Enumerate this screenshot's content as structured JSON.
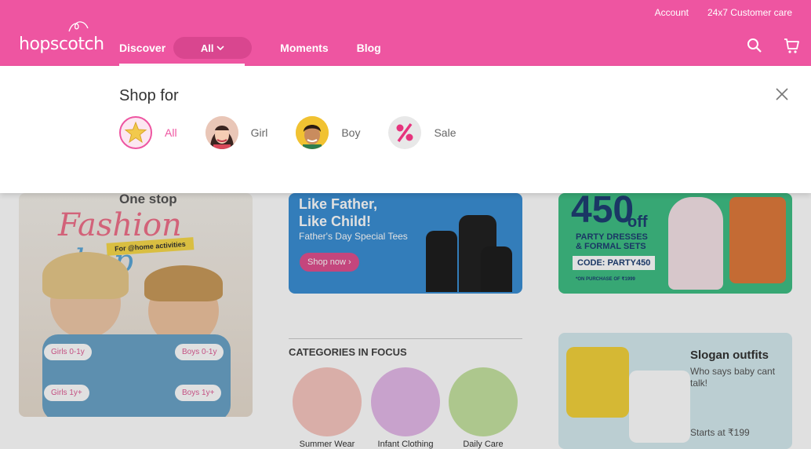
{
  "header": {
    "links": {
      "account": "Account",
      "care": "24x7 Customer care"
    },
    "logo_text": "hopscotch",
    "nav": {
      "discover": "Discover",
      "all": "All",
      "moments": "Moments",
      "blog": "Blog"
    },
    "icons": [
      "search-icon",
      "cart-icon"
    ],
    "colors": {
      "brand": "#ee55a1",
      "pill": "#d9468f"
    }
  },
  "shop_for": {
    "title": "Shop for",
    "options": [
      {
        "label": "All",
        "icon": "star-icon",
        "active": true
      },
      {
        "label": "Girl",
        "icon": "girl-avatar"
      },
      {
        "label": "Boy",
        "icon": "boy-avatar"
      },
      {
        "label": "Sale",
        "icon": "percent-icon"
      }
    ],
    "close_icon": "close-icon"
  },
  "banners": {
    "fashion": {
      "one_stop": "One stop",
      "fashion_word": "Fashion",
      "shop_word": "shop",
      "sub": "For @home activities",
      "chips": [
        "Girls 0-1y",
        "Boys 0-1y",
        "Girls 1y+",
        "Boys 1y+"
      ]
    },
    "father": {
      "title_line1": "Like Father,",
      "title_line2": "Like Child!",
      "subtitle": "Father's Day Special Tees",
      "button": "Shop now"
    },
    "party": {
      "big": "450",
      "off": "off",
      "line1": "PARTY DRESSES",
      "line2": "& FORMAL SETS",
      "code": "CODE: PARTY450",
      "note": "*ON PURCHASE OF ₹1999"
    },
    "slogan": {
      "title": "Slogan outfits",
      "subtitle": "Who says baby cant talk!",
      "price": "Starts at ₹199"
    }
  },
  "categories": {
    "heading": "CATEGORIES IN FOCUS",
    "items": [
      "Summer Wear",
      "Infant Clothing",
      "Daily Care"
    ]
  }
}
